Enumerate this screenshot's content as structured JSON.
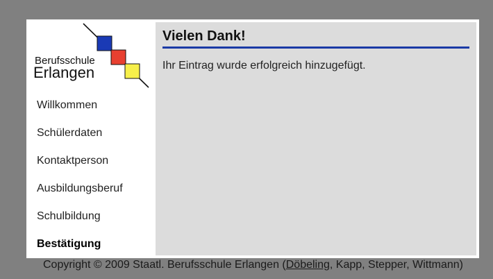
{
  "logo": {
    "line1": "Berufsschule",
    "line2": "Erlangen",
    "colors": {
      "blue": "#1a3ab5",
      "red": "#e84030",
      "yellow": "#f7f04a"
    }
  },
  "nav": {
    "items": [
      {
        "label": "Willkommen"
      },
      {
        "label": "Schülerdaten"
      },
      {
        "label": "Kontaktperson"
      },
      {
        "label": "Ausbildungsberuf"
      },
      {
        "label": "Schulbildung"
      },
      {
        "label": "Bestätigung",
        "active": true
      }
    ]
  },
  "main": {
    "title": "Vielen Dank!",
    "message": "Ihr Eintrag wurde erfolgreich hinzugefügt."
  },
  "footer": {
    "prefix": "Copyright © 2009 Staatl. Berufsschule Erlangen (",
    "link": "Döbeling",
    "suffix": ", Kapp, Stepper, Wittmann)"
  }
}
